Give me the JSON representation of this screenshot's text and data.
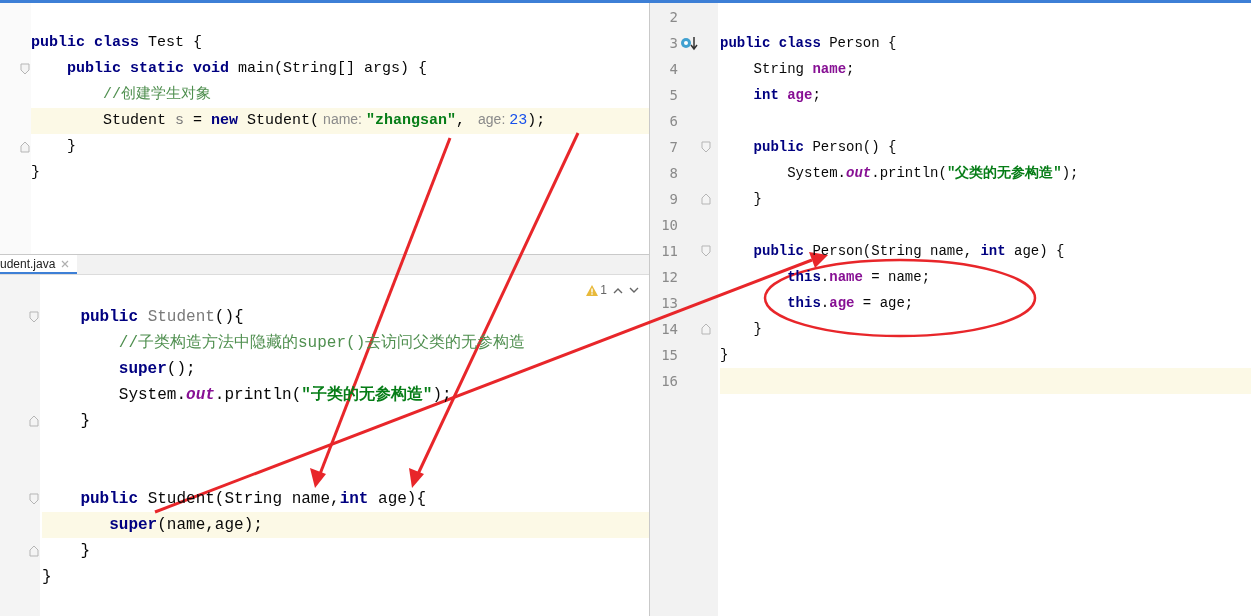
{
  "top_editor": {
    "lines": [
      {
        "current": false,
        "fold_start": false,
        "fold_end": false,
        "tokens": [
          {
            "kind": "keyword",
            "text": "public class "
          },
          {
            "kind": "plain",
            "text": "Test {"
          }
        ]
      },
      {
        "current": false,
        "fold_start": true,
        "fold_end": false,
        "tokens": [
          {
            "kind": "keyword",
            "text": "    public static void "
          },
          {
            "kind": "plain",
            "text": "main(String[] args) {"
          }
        ]
      },
      {
        "current": false,
        "fold_start": false,
        "fold_end": false,
        "tokens": [
          {
            "kind": "comment",
            "text": "        //创建学生对象"
          }
        ]
      },
      {
        "current": true,
        "fold_start": false,
        "fold_end": false,
        "tokens": [
          {
            "kind": "plain",
            "text": "        Student "
          },
          {
            "kind": "unused",
            "text": "s"
          },
          {
            "kind": "plain",
            "text": " = "
          },
          {
            "kind": "keyword",
            "text": "new "
          },
          {
            "kind": "plain",
            "text": "Student("
          },
          {
            "kind": "hint",
            "text": "name:"
          },
          {
            "kind": "string",
            "text": "\"zhangsan\""
          },
          {
            "kind": "plain",
            "text": ", "
          },
          {
            "kind": "hint",
            "text": "age:"
          },
          {
            "kind": "number",
            "text": "23"
          },
          {
            "kind": "plain",
            "text": ");"
          }
        ]
      },
      {
        "current": false,
        "fold_start": false,
        "fold_end": true,
        "tokens": [
          {
            "kind": "plain",
            "text": "    }"
          }
        ]
      },
      {
        "current": false,
        "fold_start": false,
        "fold_end": false,
        "tokens": [
          {
            "kind": "plain",
            "text": "}"
          }
        ]
      }
    ]
  },
  "bottom_editor": {
    "tab": {
      "label": "udent.java",
      "selected": true
    },
    "warning_count": "1",
    "lines": [
      {
        "current": false,
        "fold_start": true,
        "fold_end": false,
        "tokens": [
          {
            "kind": "keyword",
            "text": "    public "
          },
          {
            "kind": "unused",
            "text": "Student"
          },
          {
            "kind": "plain",
            "text": "(){"
          }
        ]
      },
      {
        "current": false,
        "fold_start": false,
        "fold_end": false,
        "tokens": [
          {
            "kind": "comment",
            "text": "        //子类构造方法中隐藏的super()去访问父类的无参构造"
          }
        ]
      },
      {
        "current": false,
        "fold_start": false,
        "fold_end": false,
        "tokens": [
          {
            "kind": "keyword",
            "text": "        super"
          },
          {
            "kind": "plain",
            "text": "();"
          }
        ]
      },
      {
        "current": false,
        "fold_start": false,
        "fold_end": false,
        "tokens": [
          {
            "kind": "plain",
            "text": "        System."
          },
          {
            "kind": "static",
            "text": "out"
          },
          {
            "kind": "plain",
            "text": ".println("
          },
          {
            "kind": "string",
            "text": "\"子类的无参构造\""
          },
          {
            "kind": "plain",
            "text": ");"
          }
        ]
      },
      {
        "current": false,
        "fold_start": false,
        "fold_end": true,
        "tokens": [
          {
            "kind": "plain",
            "text": "    }"
          }
        ]
      },
      {
        "current": false,
        "fold_start": true,
        "fold_end": false,
        "blank_lines_before": true,
        "tokens": [
          {
            "kind": "keyword",
            "text": "    public "
          },
          {
            "kind": "plain",
            "text": "Student(String name,"
          },
          {
            "kind": "keyword",
            "text": "int "
          },
          {
            "kind": "plain",
            "text": "age){"
          }
        ]
      },
      {
        "current": true,
        "fold_start": false,
        "fold_end": false,
        "tokens": [
          {
            "kind": "keyword",
            "text": "       super"
          },
          {
            "kind": "plain",
            "text": "(name,age);"
          }
        ]
      },
      {
        "current": false,
        "fold_start": false,
        "fold_end": true,
        "tokens": [
          {
            "kind": "plain",
            "text": "    }"
          }
        ]
      },
      {
        "current": false,
        "fold_start": false,
        "fold_end": false,
        "tokens": [
          {
            "kind": "plain",
            "text": "}"
          }
        ]
      }
    ]
  },
  "right_editor": {
    "lines": [
      {
        "number": "2",
        "current": false,
        "override_marker": false,
        "fold_start": false,
        "fold_end": false
      },
      {
        "number": "3",
        "current": false,
        "override_marker": true,
        "fold_start": false,
        "fold_end": false,
        "tokens": [
          {
            "kind": "keyword",
            "text": "public class "
          },
          {
            "kind": "plain",
            "text": "Person {"
          }
        ]
      },
      {
        "number": "4",
        "current": false,
        "override_marker": false,
        "fold_start": false,
        "fold_end": false,
        "tokens": [
          {
            "kind": "plain",
            "text": "    String "
          },
          {
            "kind": "field",
            "text": "name"
          },
          {
            "kind": "plain",
            "text": ";"
          }
        ]
      },
      {
        "number": "5",
        "current": false,
        "override_marker": false,
        "fold_start": false,
        "fold_end": false,
        "tokens": [
          {
            "kind": "keyword",
            "text": "    int "
          },
          {
            "kind": "field",
            "text": "age"
          },
          {
            "kind": "plain",
            "text": ";"
          }
        ]
      },
      {
        "number": "6",
        "current": false,
        "override_marker": false,
        "fold_start": false,
        "fold_end": false
      },
      {
        "number": "7",
        "current": false,
        "override_marker": false,
        "fold_start": true,
        "fold_end": false,
        "tokens": [
          {
            "kind": "keyword",
            "text": "    public "
          },
          {
            "kind": "plain",
            "text": "Person() {"
          }
        ]
      },
      {
        "number": "8",
        "current": false,
        "override_marker": false,
        "fold_start": false,
        "fold_end": false,
        "tokens": [
          {
            "kind": "plain",
            "text": "        System."
          },
          {
            "kind": "static",
            "text": "out"
          },
          {
            "kind": "plain",
            "text": ".println("
          },
          {
            "kind": "string",
            "text": "\"父类的无参构造\""
          },
          {
            "kind": "plain",
            "text": ");"
          }
        ]
      },
      {
        "number": "9",
        "current": false,
        "override_marker": false,
        "fold_start": false,
        "fold_end": true,
        "tokens": [
          {
            "kind": "plain",
            "text": "    }"
          }
        ]
      },
      {
        "number": "10",
        "current": false,
        "override_marker": false,
        "fold_start": false,
        "fold_end": false
      },
      {
        "number": "11",
        "current": false,
        "override_marker": false,
        "fold_start": true,
        "fold_end": false,
        "tokens": [
          {
            "kind": "keyword",
            "text": "    public "
          },
          {
            "kind": "plain",
            "text": "Person(String name, "
          },
          {
            "kind": "keyword",
            "text": "int "
          },
          {
            "kind": "plain",
            "text": "age) {"
          }
        ]
      },
      {
        "number": "12",
        "current": false,
        "override_marker": false,
        "fold_start": false,
        "fold_end": false,
        "tokens": [
          {
            "kind": "keyword",
            "text": "        this"
          },
          {
            "kind": "plain",
            "text": "."
          },
          {
            "kind": "field",
            "text": "name"
          },
          {
            "kind": "plain",
            "text": " = name;"
          }
        ]
      },
      {
        "number": "13",
        "current": false,
        "override_marker": false,
        "fold_start": false,
        "fold_end": false,
        "tokens": [
          {
            "kind": "keyword",
            "text": "        this"
          },
          {
            "kind": "plain",
            "text": "."
          },
          {
            "kind": "field",
            "text": "age"
          },
          {
            "kind": "plain",
            "text": " = age;"
          }
        ]
      },
      {
        "number": "14",
        "current": false,
        "override_marker": false,
        "fold_start": false,
        "fold_end": true,
        "tokens": [
          {
            "kind": "plain",
            "text": "    }"
          }
        ]
      },
      {
        "number": "15",
        "current": false,
        "override_marker": false,
        "fold_start": false,
        "fold_end": false,
        "tokens": [
          {
            "kind": "plain",
            "text": "}"
          }
        ]
      },
      {
        "number": "16",
        "current": true,
        "override_marker": false,
        "fold_start": false,
        "fold_end": false
      }
    ]
  }
}
